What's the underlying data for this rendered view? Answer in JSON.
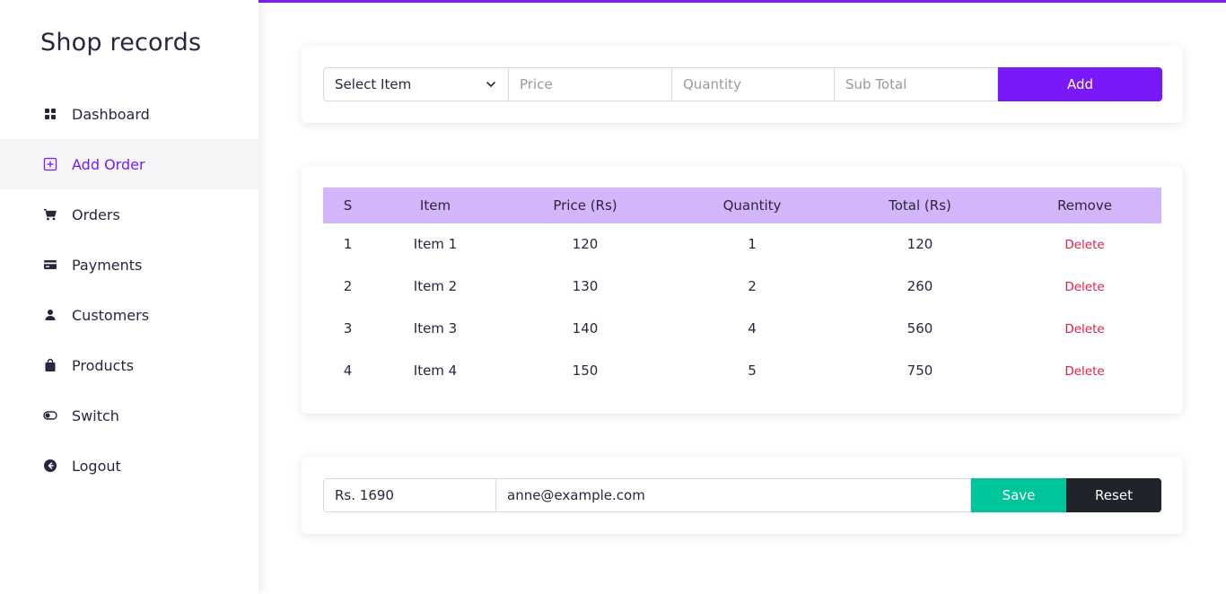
{
  "brand": "Shop records",
  "nav": [
    {
      "label": "Dashboard",
      "icon": "dashboard-grid-icon"
    },
    {
      "label": "Add Order",
      "icon": "plus-square-icon",
      "active": true
    },
    {
      "label": "Orders",
      "icon": "cart-icon"
    },
    {
      "label": "Payments",
      "icon": "credit-card-icon"
    },
    {
      "label": "Customers",
      "icon": "user-icon"
    },
    {
      "label": "Products",
      "icon": "bag-icon"
    },
    {
      "label": "Switch",
      "icon": "toggle-icon"
    },
    {
      "label": "Logout",
      "icon": "logout-arrow-icon"
    }
  ],
  "add_form": {
    "item_select": "Select Item",
    "price_placeholder": "Price",
    "quantity_placeholder": "Quantity",
    "subtotal_placeholder": "Sub Total",
    "add_label": "Add"
  },
  "table": {
    "headers": [
      "S",
      "Item",
      "Price (Rs)",
      "Quantity",
      "Total (Rs)",
      "Remove"
    ],
    "rows": [
      {
        "s": "1",
        "item": "Item 1",
        "price": "120",
        "qty": "1",
        "total": "120",
        "remove": "Delete"
      },
      {
        "s": "2",
        "item": "Item 2",
        "price": "130",
        "qty": "2",
        "total": "260",
        "remove": "Delete"
      },
      {
        "s": "3",
        "item": "Item 3",
        "price": "140",
        "qty": "4",
        "total": "560",
        "remove": "Delete"
      },
      {
        "s": "4",
        "item": "Item 4",
        "price": "150",
        "qty": "5",
        "total": "750",
        "remove": "Delete"
      }
    ]
  },
  "summary": {
    "total_value": "Rs. 1690",
    "email_value": "anne@example.com",
    "save_label": "Save",
    "reset_label": "Reset"
  },
  "colors": {
    "accent": "#7918f9",
    "table_header": "#d3b5fc",
    "save": "#00c49a",
    "reset": "#20232a",
    "delete": "#e11d48"
  }
}
